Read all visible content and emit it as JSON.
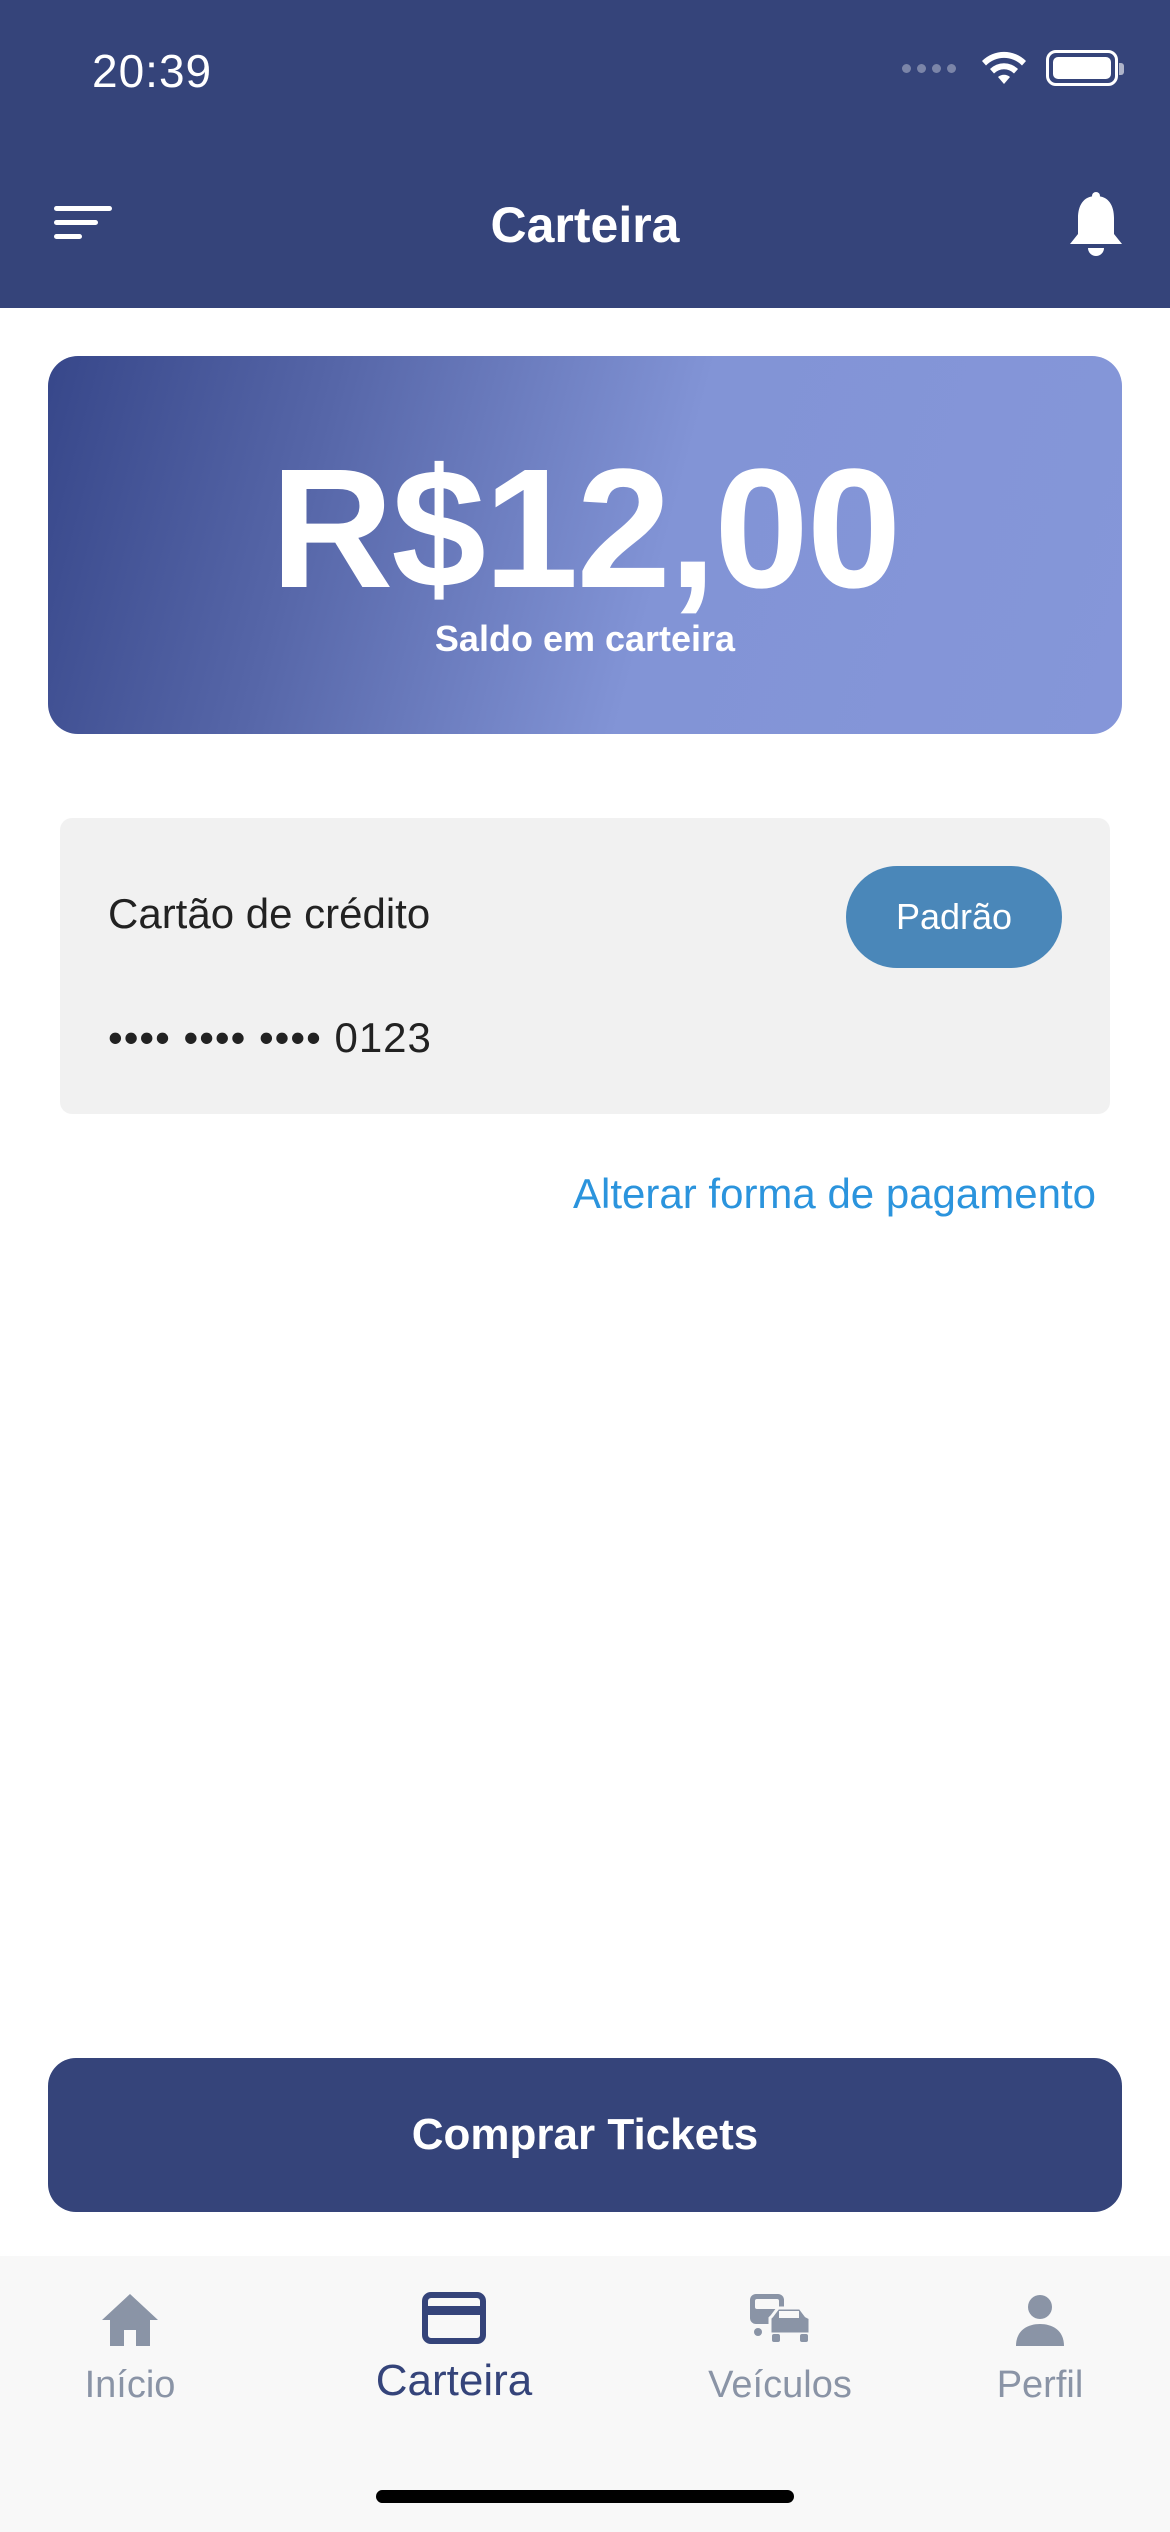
{
  "status_bar": {
    "time": "20:39"
  },
  "header": {
    "title": "Carteira"
  },
  "balance": {
    "amount": "R$12,00",
    "label": "Saldo em carteira"
  },
  "payment": {
    "type": "Cartão de crédito",
    "badge": "Padrão",
    "card_number": "•••• •••• •••• 0123"
  },
  "change_payment_link": "Alterar forma de pagamento",
  "buy_button": "Comprar Tickets",
  "tabs": [
    {
      "label": "Início",
      "icon": "home-icon",
      "active": false
    },
    {
      "label": "Carteira",
      "icon": "wallet-card-icon",
      "active": true
    },
    {
      "label": "Veículos",
      "icon": "vehicles-icon",
      "active": false
    },
    {
      "label": "Perfil",
      "icon": "person-icon",
      "active": false
    }
  ],
  "colors": {
    "primary": "#35447a",
    "link": "#2b94dd",
    "badge": "#4a87b9",
    "tab_inactive": "#8a94a6"
  }
}
